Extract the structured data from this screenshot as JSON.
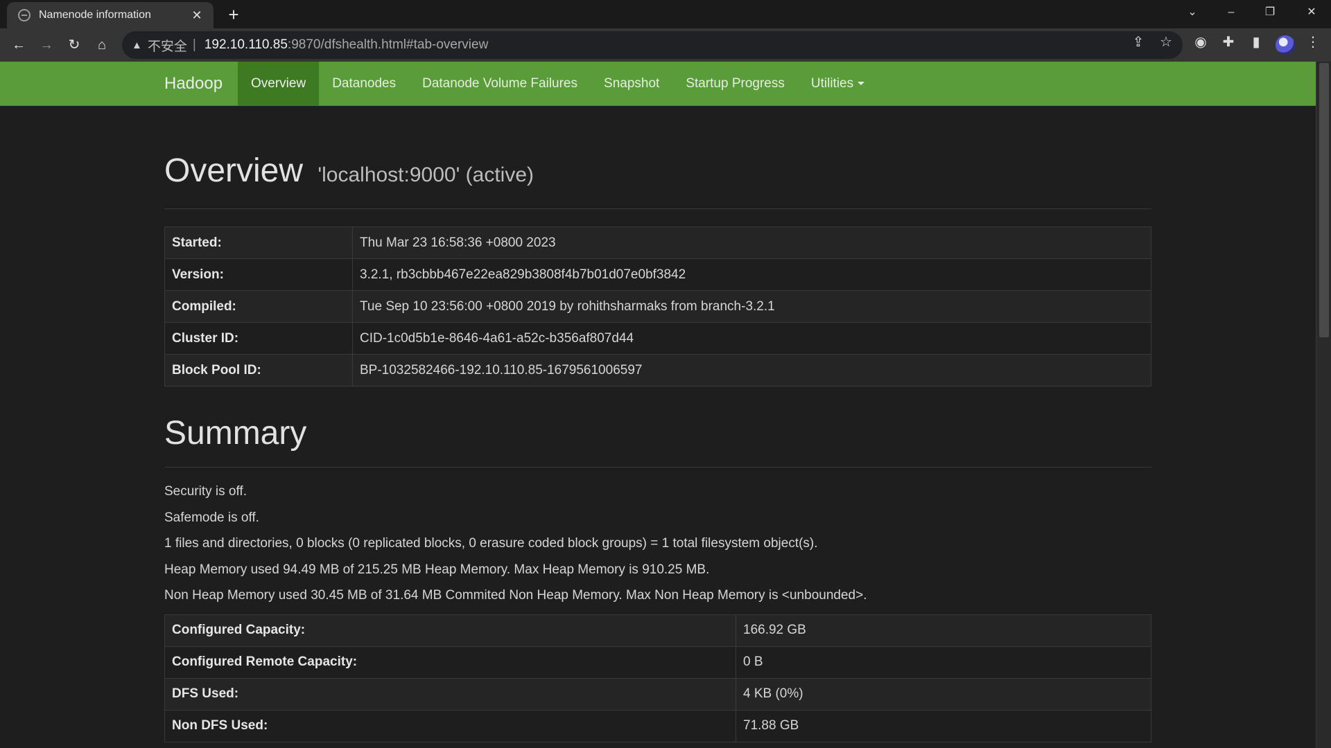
{
  "browser": {
    "tab_title": "Namenode information",
    "insecure_label": "不安全",
    "separator": "|",
    "url_host": "192.10.110.85",
    "url_path": ":9870/dfshealth.html#tab-overview"
  },
  "navbar": {
    "brand": "Hadoop",
    "items": [
      {
        "label": "Overview",
        "active": true
      },
      {
        "label": "Datanodes",
        "active": false
      },
      {
        "label": "Datanode Volume Failures",
        "active": false
      },
      {
        "label": "Snapshot",
        "active": false
      },
      {
        "label": "Startup Progress",
        "active": false
      },
      {
        "label": "Utilities",
        "active": false,
        "dropdown": true
      }
    ]
  },
  "overview": {
    "title": "Overview",
    "subtitle": "'localhost:9000' (active)",
    "rows": [
      {
        "label": "Started:",
        "value": "Thu Mar 23 16:58:36 +0800 2023"
      },
      {
        "label": "Version:",
        "value": "3.2.1, rb3cbbb467e22ea829b3808f4b7b01d07e0bf3842"
      },
      {
        "label": "Compiled:",
        "value": "Tue Sep 10 23:56:00 +0800 2019 by rohithsharmaks from branch-3.2.1"
      },
      {
        "label": "Cluster ID:",
        "value": "CID-1c0d5b1e-8646-4a61-a52c-b356af807d44"
      },
      {
        "label": "Block Pool ID:",
        "value": "BP-1032582466-192.10.110.85-1679561006597"
      }
    ]
  },
  "summary": {
    "title": "Summary",
    "lines": [
      "Security is off.",
      "Safemode is off.",
      "1 files and directories, 0 blocks (0 replicated blocks, 0 erasure coded block groups) = 1 total filesystem object(s).",
      "Heap Memory used 94.49 MB of 215.25 MB Heap Memory. Max Heap Memory is 910.25 MB.",
      "Non Heap Memory used 30.45 MB of 31.64 MB Commited Non Heap Memory. Max Non Heap Memory is <unbounded>."
    ],
    "rows": [
      {
        "label": "Configured Capacity:",
        "value": "166.92 GB"
      },
      {
        "label": "Configured Remote Capacity:",
        "value": "0 B"
      },
      {
        "label": "DFS Used:",
        "value": "4 KB (0%)"
      },
      {
        "label": "Non DFS Used:",
        "value": "71.88 GB"
      }
    ]
  },
  "colors": {
    "navbar": "#5b9c3a",
    "navbar_active": "#3d7a22",
    "page_background": "#1e1e1e"
  }
}
